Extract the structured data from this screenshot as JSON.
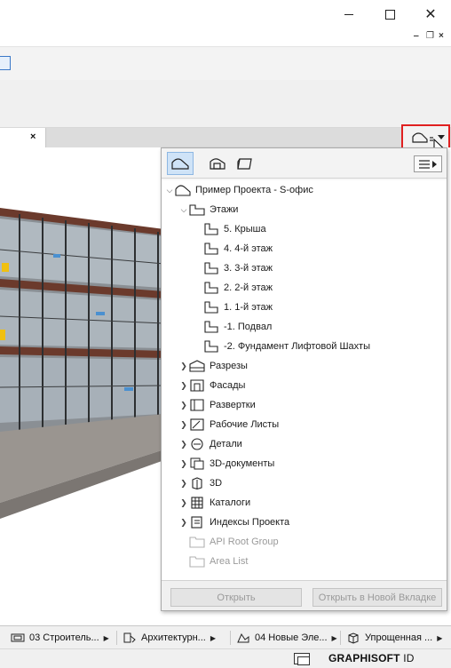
{
  "window": {
    "minimize_icon": "minimize-icon",
    "maximize_icon": "maximize-icon",
    "close_glyph": "✕"
  },
  "mdi_controls": {
    "minimize": "‒",
    "restore": "❐",
    "close": "×"
  },
  "tab": {
    "close_glyph": "×"
  },
  "navigator": {
    "tree": [
      {
        "id": "project",
        "label": "Пример Проекта - S-офис",
        "arrow": "⌄",
        "icon": "project-icon",
        "indent": 0,
        "dim": false
      },
      {
        "id": "stories",
        "label": "Этажи",
        "arrow": "⌄",
        "icon": "stories-folder-icon",
        "indent": 1,
        "dim": false
      },
      {
        "id": "story-5",
        "label": "5. Крыша",
        "arrow": "",
        "icon": "story-icon",
        "indent": 2,
        "dim": false
      },
      {
        "id": "story-4",
        "label": "4. 4-й этаж",
        "arrow": "",
        "icon": "story-icon",
        "indent": 2,
        "dim": false
      },
      {
        "id": "story-3",
        "label": "3. 3-й этаж",
        "arrow": "",
        "icon": "story-icon",
        "indent": 2,
        "dim": false
      },
      {
        "id": "story-2",
        "label": "2. 2-й этаж",
        "arrow": "",
        "icon": "story-icon",
        "indent": 2,
        "dim": false
      },
      {
        "id": "story-1",
        "label": "1. 1-й этаж",
        "arrow": "",
        "icon": "story-icon",
        "indent": 2,
        "dim": false
      },
      {
        "id": "story-m1",
        "label": "-1. Подвал",
        "arrow": "",
        "icon": "story-icon",
        "indent": 2,
        "dim": false
      },
      {
        "id": "story-m2",
        "label": "-2. Фундамент Лифтовой Шахты",
        "arrow": "",
        "icon": "story-icon",
        "indent": 2,
        "dim": false
      },
      {
        "id": "sections",
        "label": "Разрезы",
        "arrow": "›",
        "icon": "section-icon",
        "indent": 1,
        "dim": false
      },
      {
        "id": "elevations",
        "label": "Фасады",
        "arrow": "›",
        "icon": "elevation-icon",
        "indent": 1,
        "dim": false
      },
      {
        "id": "interior-elevations",
        "label": "Развертки",
        "arrow": "›",
        "icon": "interior-elevation-icon",
        "indent": 1,
        "dim": false
      },
      {
        "id": "worksheets",
        "label": "Рабочие Листы",
        "arrow": "›",
        "icon": "worksheet-icon",
        "indent": 1,
        "dim": false
      },
      {
        "id": "details",
        "label": "Детали",
        "arrow": "›",
        "icon": "detail-icon",
        "indent": 1,
        "dim": false
      },
      {
        "id": "3d-documents",
        "label": "3D-документы",
        "arrow": "›",
        "icon": "3d-document-icon",
        "indent": 1,
        "dim": false
      },
      {
        "id": "3d",
        "label": "3D",
        "arrow": "›",
        "icon": "3d-icon",
        "indent": 1,
        "dim": false
      },
      {
        "id": "schedules",
        "label": "Каталоги",
        "arrow": "›",
        "icon": "schedule-icon",
        "indent": 1,
        "dim": false
      },
      {
        "id": "project-indexes",
        "label": "Индексы Проекта",
        "arrow": "›",
        "icon": "project-index-icon",
        "indent": 1,
        "dim": false
      },
      {
        "id": "api-root-group",
        "label": "API Root Group",
        "arrow": "",
        "icon": "folder-icon",
        "indent": 1,
        "dim": true
      },
      {
        "id": "area-list",
        "label": "Area List",
        "arrow": "",
        "icon": "folder-icon",
        "indent": 1,
        "dim": true
      }
    ],
    "buttons": {
      "open": "Открыть",
      "open_new_tab": "Открыть в Новой Вкладке"
    }
  },
  "statusbar": {
    "items": [
      {
        "label": "03 Строитель...",
        "icon": "layer-combination-icon"
      },
      {
        "label": "Архитектурн...",
        "icon": "pen-set-icon"
      },
      {
        "label": "04 Новые Эле...",
        "icon": "renovation-filter-icon"
      },
      {
        "label": "Упрощенная ...",
        "icon": "model-view-icon"
      }
    ]
  },
  "brand": {
    "name": "GRAPHISOFT",
    "suffix": "ID"
  }
}
